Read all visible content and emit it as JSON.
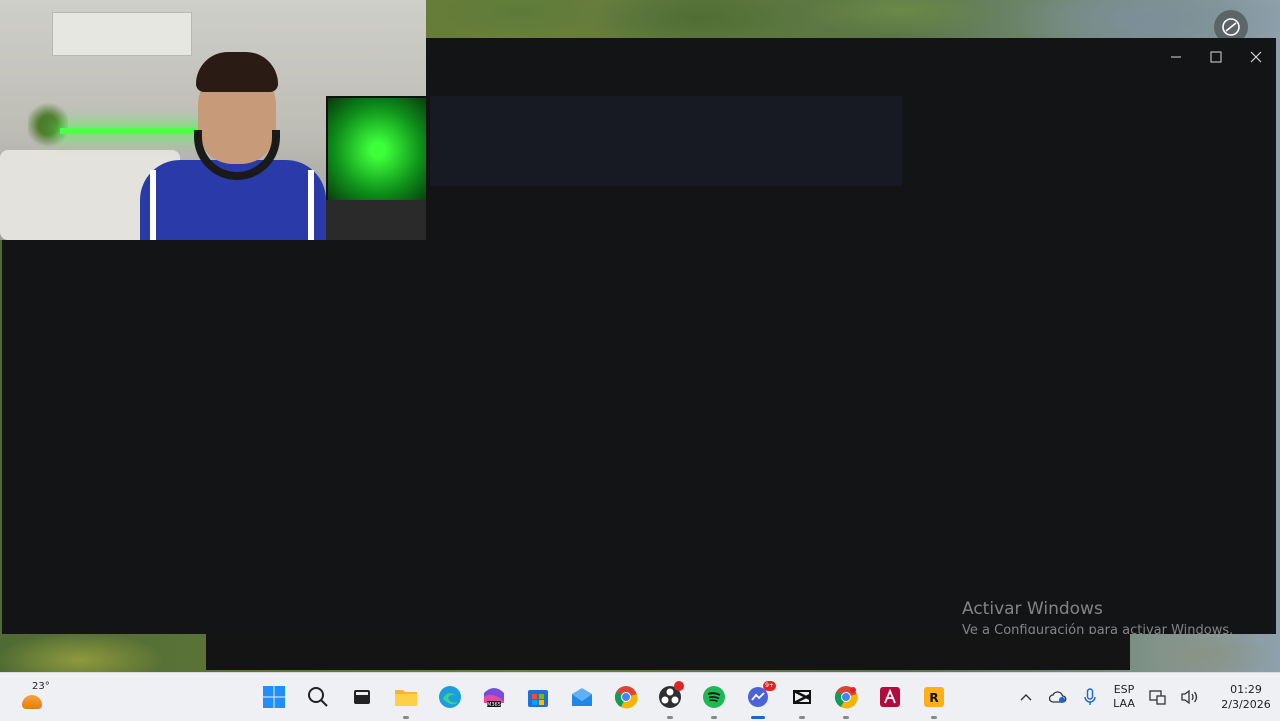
{
  "window": {
    "controls": {
      "minimize": "—",
      "maximize": "☐",
      "close": "✕"
    }
  },
  "watermark": {
    "title": "Activar Windows",
    "subtitle": "Ve a Configuración para activar Windows."
  },
  "taskbar": {
    "weather": {
      "temperature": "23°"
    },
    "apps": [
      {
        "name": "start-button",
        "icon": "windows-icon"
      },
      {
        "name": "search-button",
        "icon": "search-icon"
      },
      {
        "name": "task-view-button",
        "icon": "task-view-icon"
      },
      {
        "name": "file-explorer",
        "icon": "folder-icon"
      },
      {
        "name": "edge",
        "icon": "edge-icon"
      },
      {
        "name": "m365",
        "icon": "m365-icon",
        "label": "M365"
      },
      {
        "name": "store",
        "icon": "store-icon"
      },
      {
        "name": "outlook",
        "icon": "outlook-icon"
      },
      {
        "name": "chrome",
        "icon": "chrome-icon"
      },
      {
        "name": "obs",
        "icon": "obs-icon"
      },
      {
        "name": "spotify",
        "icon": "spotify-icon"
      },
      {
        "name": "messenger",
        "icon": "messenger-icon",
        "badge": "9+"
      },
      {
        "name": "capcut",
        "icon": "capcut-icon"
      },
      {
        "name": "chrome-profile",
        "icon": "chrome-icon"
      },
      {
        "name": "adobe-app",
        "icon": "adobe-icon"
      },
      {
        "name": "rockstar",
        "icon": "rockstar-icon"
      }
    ],
    "tray": {
      "language": {
        "line1": "ESP",
        "line2": "LAA"
      },
      "time": "01:29",
      "date": "2/3/2026"
    }
  },
  "colors": {
    "window_bg": "#131416",
    "taskbar_bg": "#eef0f3",
    "accent": "#1a66d4"
  }
}
